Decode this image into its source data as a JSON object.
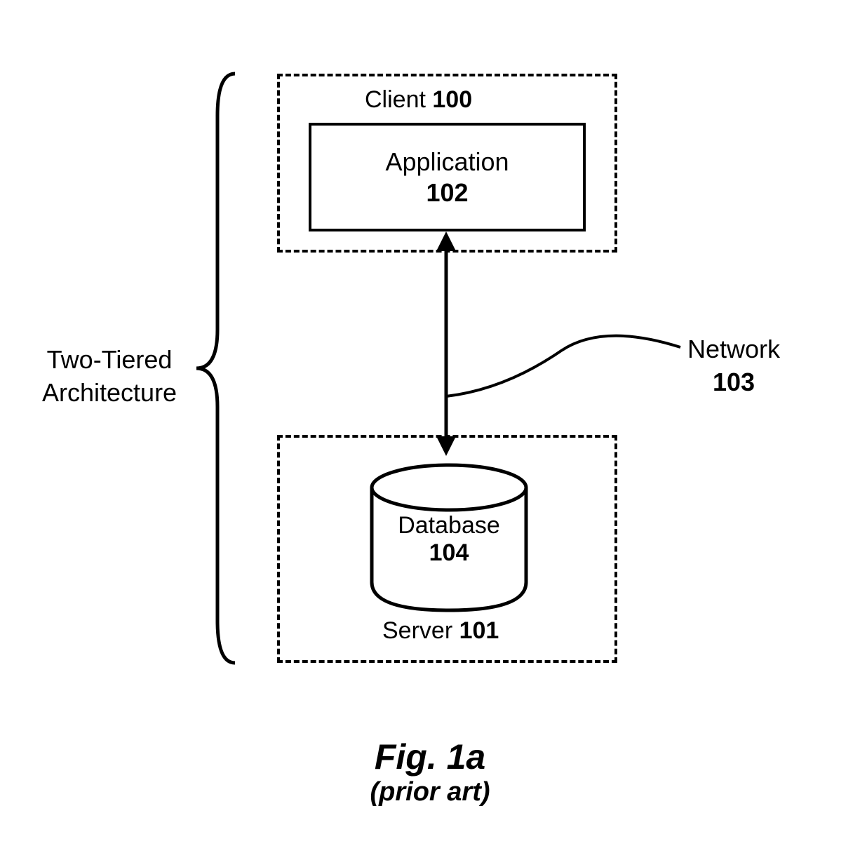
{
  "diagram": {
    "architecture_label_line1": "Two-Tiered",
    "architecture_label_line2": "Architecture",
    "client": {
      "label": "Client",
      "ref": "100"
    },
    "application": {
      "label": "Application",
      "ref": "102"
    },
    "server": {
      "label": "Server",
      "ref": "101"
    },
    "database": {
      "label": "Database",
      "ref": "104"
    },
    "network": {
      "label": "Network",
      "ref": "103"
    },
    "figure": {
      "number": "Fig. 1a",
      "note": "(prior art)"
    }
  }
}
